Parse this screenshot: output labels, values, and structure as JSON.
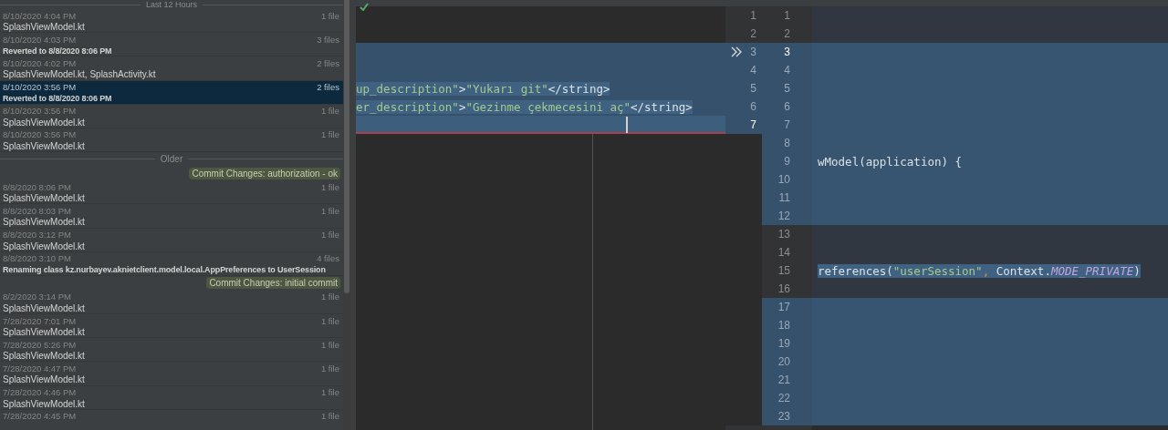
{
  "history": {
    "groups": [
      {
        "title": "Last 12 Hours",
        "items": [
          {
            "kind": "change",
            "date": "8/10/2020 4:04 PM",
            "files": "1 file",
            "name": "SplashViewModel.kt",
            "selected": false
          },
          {
            "kind": "revert",
            "date": "8/10/2020 4:03 PM",
            "files": "3 files",
            "name": "Reverted to 8/8/2020 8:06 PM",
            "selected": false
          },
          {
            "kind": "change",
            "date": "8/10/2020 4:02 PM",
            "files": "2 files",
            "name": "SplashViewModel.kt, SplashActivity.kt",
            "selected": false
          },
          {
            "kind": "revert",
            "date": "8/10/2020 3:56 PM",
            "files": "2 files",
            "name": "Reverted to 8/8/2020 8:06 PM",
            "selected": true
          },
          {
            "kind": "change",
            "date": "8/10/2020 3:56 PM",
            "files": "1 file",
            "name": "SplashViewModel.kt",
            "selected": false
          },
          {
            "kind": "change",
            "date": "8/10/2020 3:56 PM",
            "files": "1 file",
            "name": "SplashViewModel.kt",
            "selected": false
          }
        ]
      },
      {
        "title": "Older",
        "items": [
          {
            "kind": "label",
            "text": "Commit Changes: authorization - ok"
          },
          {
            "kind": "change",
            "date": "8/8/2020 8:06 PM",
            "files": "1 file",
            "name": "SplashViewModel.kt",
            "selected": false
          },
          {
            "kind": "change",
            "date": "8/8/2020 8:03 PM",
            "files": "1 file",
            "name": "SplashViewModel.kt",
            "selected": false
          },
          {
            "kind": "change",
            "date": "8/8/2020 3:12 PM",
            "files": "1 file",
            "name": "SplashViewModel.kt",
            "selected": false
          },
          {
            "kind": "revert",
            "date": "8/8/2020 3:10 PM",
            "files": "4 files",
            "name": "Renaming class kz.nurbayev.aknietclient.model.local.AppPreferences to UserSession",
            "selected": false
          },
          {
            "kind": "label",
            "text": "Commit Changes: initial commit"
          },
          {
            "kind": "change",
            "date": "8/2/2020 3:14 PM",
            "files": "1 file",
            "name": "SplashViewModel.kt",
            "selected": false
          },
          {
            "kind": "change",
            "date": "7/28/2020 7:01 PM",
            "files": "1 file",
            "name": "SplashViewModel.kt",
            "selected": false
          },
          {
            "kind": "change",
            "date": "7/28/2020 5:26 PM",
            "files": "1 file",
            "name": "SplashViewModel.kt",
            "selected": false
          },
          {
            "kind": "change",
            "date": "7/28/2020 4:47 PM",
            "files": "1 file",
            "name": "SplashViewModel.kt",
            "selected": false
          },
          {
            "kind": "change",
            "date": "7/28/2020 4:46 PM",
            "files": "1 file",
            "name": "SplashViewModel.kt",
            "selected": false
          },
          {
            "kind": "change",
            "date": "7/28/2020 4:45 PM",
            "files": "1 file",
            "selected": false
          }
        ]
      }
    ]
  },
  "diff": {
    "left": {
      "lines": [
        {
          "number": "1",
          "changed": false,
          "current": false,
          "selected": false
        },
        {
          "number": "2",
          "changed": false,
          "current": false,
          "selected": false
        },
        {
          "number": "3",
          "changed": true,
          "current": false,
          "selected": false
        },
        {
          "number": "4",
          "changed": true,
          "current": false,
          "selected": false
        },
        {
          "number": "5",
          "changed": true,
          "current": false,
          "selected": true,
          "segments": [
            {
              "kind": "string",
              "text": "up_description\""
            },
            {
              "kind": "plain",
              "text": ">"
            },
            {
              "kind": "string",
              "text": "\"Yukarı git\""
            },
            {
              "kind": "plain",
              "text": "</string>"
            }
          ]
        },
        {
          "number": "6",
          "changed": true,
          "current": false,
          "selected": true,
          "segments": [
            {
              "kind": "string",
              "text": "er_description\""
            },
            {
              "kind": "plain",
              "text": ">"
            },
            {
              "kind": "string",
              "text": "\"Gezinme çekmecesini aç\""
            },
            {
              "kind": "plain",
              "text": "</string>"
            }
          ]
        },
        {
          "number": "7",
          "changed": true,
          "current": true,
          "selected": true,
          "caret": true
        }
      ]
    },
    "right": {
      "lines": [
        {
          "number": "1",
          "changed": false,
          "current": false
        },
        {
          "number": "2",
          "changed": false,
          "current": false
        },
        {
          "number": "3",
          "changed": true,
          "current": true
        },
        {
          "number": "4",
          "changed": true,
          "current": false
        },
        {
          "number": "5",
          "changed": true,
          "current": false
        },
        {
          "number": "6",
          "changed": true,
          "current": false
        },
        {
          "number": "7",
          "changed": true,
          "current": false
        },
        {
          "number": "8",
          "changed": true,
          "current": false
        },
        {
          "number": "9",
          "changed": true,
          "current": false,
          "selected": false,
          "segments": [
            {
              "kind": "plain",
              "text": "wModel(application) {"
            }
          ]
        },
        {
          "number": "10",
          "changed": true,
          "current": false
        },
        {
          "number": "11",
          "changed": true,
          "current": false
        },
        {
          "number": "12",
          "changed": true,
          "current": false
        },
        {
          "number": "13",
          "changed": false,
          "current": false
        },
        {
          "number": "14",
          "changed": false,
          "current": false
        },
        {
          "number": "15",
          "changed": false,
          "current": false,
          "selected": true,
          "segments": [
            {
              "kind": "plain",
              "text": "references("
            },
            {
              "kind": "string",
              "text": "\"userSession\""
            },
            {
              "kind": "comma",
              "text": ", "
            },
            {
              "kind": "plain",
              "text": "Context."
            },
            {
              "kind": "constant",
              "text": "MODE_PRIVATE"
            },
            {
              "kind": "plain",
              "text": ")"
            }
          ]
        },
        {
          "number": "16",
          "changed": false,
          "current": false
        },
        {
          "number": "17",
          "changed": true,
          "current": false
        },
        {
          "number": "18",
          "changed": true,
          "current": false
        },
        {
          "number": "19",
          "changed": true,
          "current": false
        },
        {
          "number": "20",
          "changed": true,
          "current": false
        },
        {
          "number": "21",
          "changed": true,
          "current": false
        },
        {
          "number": "22",
          "changed": true,
          "current": false
        },
        {
          "number": "23",
          "changed": true,
          "current": false
        }
      ]
    }
  }
}
